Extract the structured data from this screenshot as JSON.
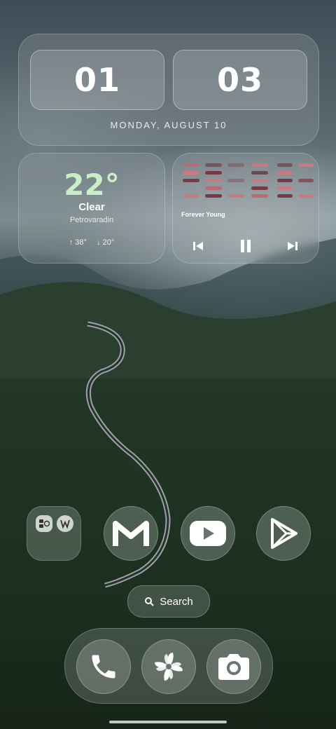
{
  "clock": {
    "hour": "01",
    "minute": "03",
    "date": "MONDAY, AUGUST 10"
  },
  "weather": {
    "temperature": "22°",
    "condition": "Clear",
    "location": "Petrovaradin",
    "high": "↑ 38°",
    "low": "↓ 20°"
  },
  "media": {
    "track_title": "Forever Young"
  },
  "search": {
    "label": "Search"
  },
  "icons": {
    "folder_apps": [
      "calendar-app-icon",
      "wear-app-icon"
    ],
    "home_apps": [
      "gmail-icon",
      "youtube-icon",
      "play-store-icon"
    ],
    "dock_apps": [
      "phone-icon",
      "pinwheel-app-icon",
      "camera-icon"
    ]
  },
  "colors": {
    "temperature": "#c9efc9",
    "eq_red": "#c97a80",
    "eq_dark_red": "#7a3a45"
  }
}
